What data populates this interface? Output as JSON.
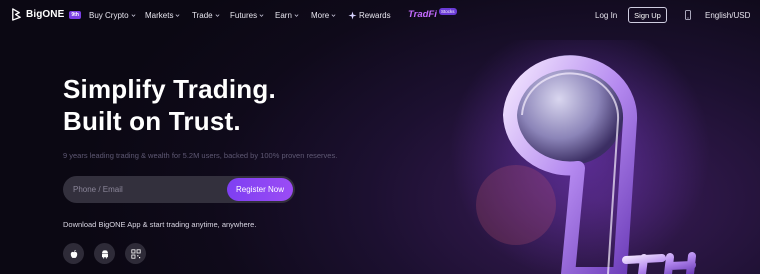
{
  "nav": {
    "logo_text": "BigONE",
    "logo_badge": "9th",
    "buy_crypto": "Buy Crypto",
    "markets": "Markets",
    "trade": "Trade",
    "futures": "Futures",
    "earn": "Earn",
    "more": "More",
    "rewards": "Rewards",
    "tradfi": "TradFi",
    "tradfi_badge": "Stocks",
    "login": "Log In",
    "signup": "Sign Up",
    "language": "English/USD"
  },
  "hero": {
    "title_line1": "Simplify Trading.",
    "title_line2": "Built on Trust.",
    "subtitle": "9 years leading trading & wealth for 5.2M users, backed by 100% proven reserves.",
    "input_placeholder": "Phone / Email",
    "register_label": "Register Now",
    "download_text": "Download BigONE App & start trading anytime, anywhere."
  },
  "art": {
    "number": "9",
    "suffix": "TH"
  },
  "colors": {
    "accent": "#8a45f3",
    "background": "#0f0a1a",
    "tradfi": "#c46bff"
  },
  "icons": {
    "apple": "apple-icon",
    "android": "android-icon",
    "qr": "qr-code-icon"
  }
}
